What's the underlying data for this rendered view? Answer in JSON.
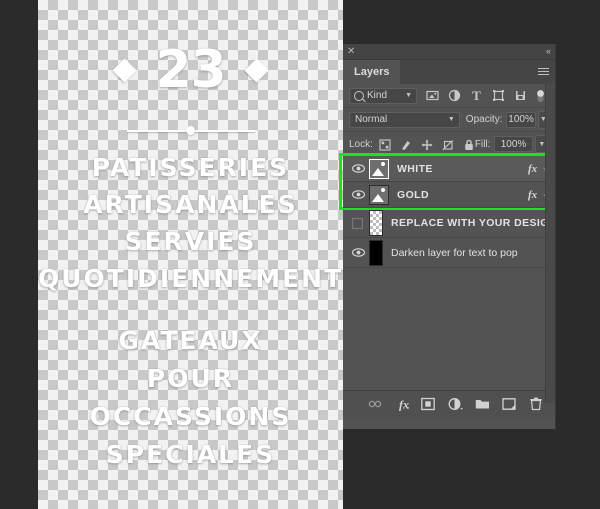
{
  "canvas": {
    "number": "23",
    "decoration_left": "diamond",
    "decoration_right": "diamond",
    "divider": "line-with-dot",
    "block_top": [
      "PATISSERIES",
      "ARTISANALES",
      "SERVIES",
      "QUOTIDIENNEMENT"
    ],
    "block_bottom": [
      "GATEAUX",
      "POUR",
      "OCCASSIONS",
      "SPECIALES"
    ],
    "text_color": "#ffffff",
    "background": "transparent-checkerboard"
  },
  "panel": {
    "title_bar": {
      "close_icon": "✕",
      "collapse_icon": "«"
    },
    "tabs": [
      {
        "label": "Layers",
        "active": true
      }
    ],
    "menu_icon": "hamburger-icon",
    "filter": {
      "search_icon": "search-icon",
      "kind_label": "Kind",
      "chevron": "⌄",
      "icons": [
        "pixel-layer-filter-icon",
        "adjustment-layer-filter-icon",
        "type-layer-filter-icon",
        "shape-layer-filter-icon",
        "smart-object-filter-icon"
      ],
      "toggle": "filter-enable-toggle"
    },
    "blend": {
      "mode": "Normal",
      "chevron": "⌄",
      "opacity_label": "Opacity:",
      "opacity_value": "100%"
    },
    "lock": {
      "label": "Lock:",
      "icons": [
        "lock-transparent-pixels-icon",
        "lock-image-pixels-icon",
        "lock-position-icon",
        "lock-artboard-nesting-icon",
        "lock-all-icon"
      ],
      "fill_label": "Fill:",
      "fill_value": "100%"
    },
    "layers": [
      {
        "name": "WHITE",
        "visible": true,
        "selected": true,
        "highlighted": true,
        "thumbnail": "image-thumbnail",
        "has_effects": true,
        "fx_label": "fx",
        "expand_chevron": "⌄",
        "caps": true
      },
      {
        "name": "GOLD",
        "visible": true,
        "selected": false,
        "highlighted": true,
        "thumbnail": "image-thumbnail",
        "has_effects": true,
        "fx_label": "fx",
        "expand_chevron": "⌄",
        "caps": true
      },
      {
        "name": "REPLACE WITH YOUR DESIGN",
        "visible": false,
        "selected": false,
        "highlighted": false,
        "thumbnail": "transparent-thumbnail",
        "has_effects": false,
        "caps": true
      },
      {
        "name": "Darken layer for text to pop",
        "visible": true,
        "selected": false,
        "highlighted": false,
        "thumbnail": "black-thumbnail",
        "has_effects": false,
        "caps": false
      }
    ],
    "highlight_color": "#19e619",
    "bottom_toolbar": [
      "link-layers-icon",
      "add-layer-style-icon",
      "add-layer-mask-icon",
      "new-adjustment-layer-icon",
      "new-group-icon",
      "new-layer-icon",
      "delete-layer-icon"
    ]
  }
}
